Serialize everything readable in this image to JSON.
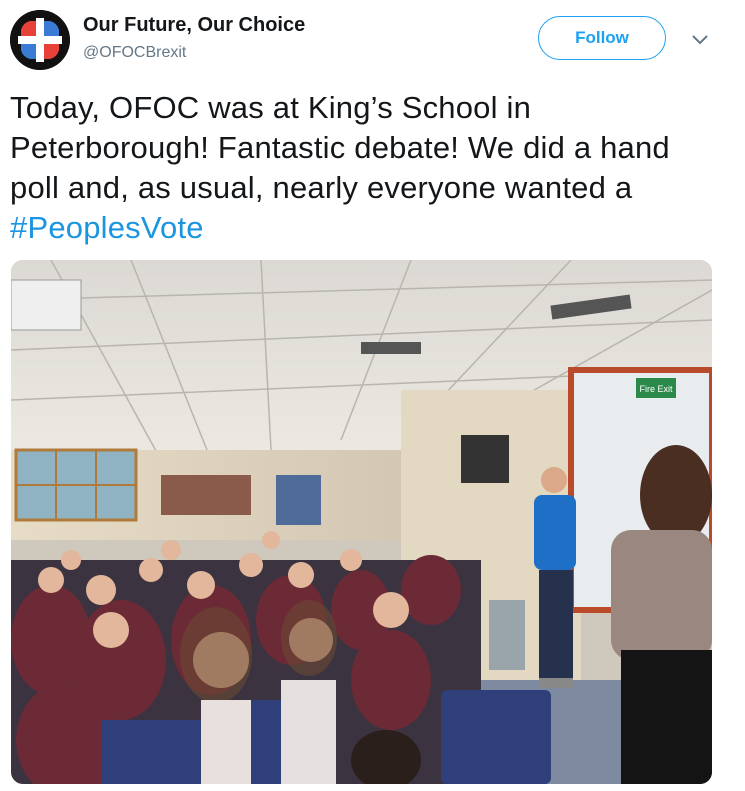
{
  "author": {
    "name": "Our Future, Our Choice",
    "handle": "@OFOCBrexit",
    "avatar_icon": "cross-logo-icon"
  },
  "follow_button": {
    "label": "Follow"
  },
  "menu": {
    "icon": "chevron-down-icon"
  },
  "tweet": {
    "text": "Today, OFOC was at King’s School in Peterborough! Fantastic debate! We did a hand poll and, as usual, nearly everyone wanted a ",
    "hashtag": "#PeoplesVote"
  },
  "media": {
    "sign_text": "Fire Exit"
  },
  "colors": {
    "accent": "#1da1f2",
    "text": "#14171a",
    "muted": "#657786",
    "logo_red": "#e8413a",
    "logo_blue": "#3a7bd5"
  }
}
